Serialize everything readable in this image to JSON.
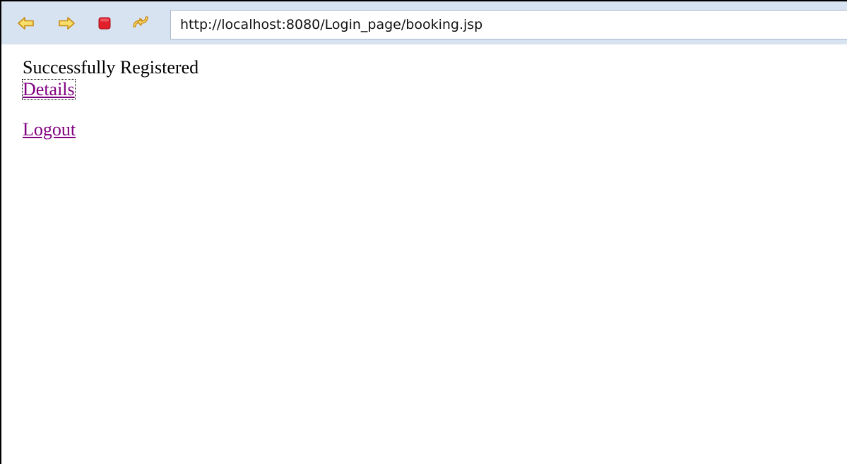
{
  "browser": {
    "address_url": "http://localhost:8080/Login_page/booking.jsp",
    "icons": {
      "back": "back-arrow-icon",
      "forward": "forward-arrow-icon",
      "stop": "stop-icon",
      "refresh": "refresh-icon"
    },
    "colors": {
      "toolbar_bg": "#d8e3f1",
      "arrow_fill": "#f7dd6a",
      "arrow_stroke": "#c98b12",
      "stop_red": "#e2202c"
    }
  },
  "page": {
    "message": "Successfully Registered",
    "details_link": "Details",
    "logout_link": "Logout",
    "link_color": "#800080"
  }
}
